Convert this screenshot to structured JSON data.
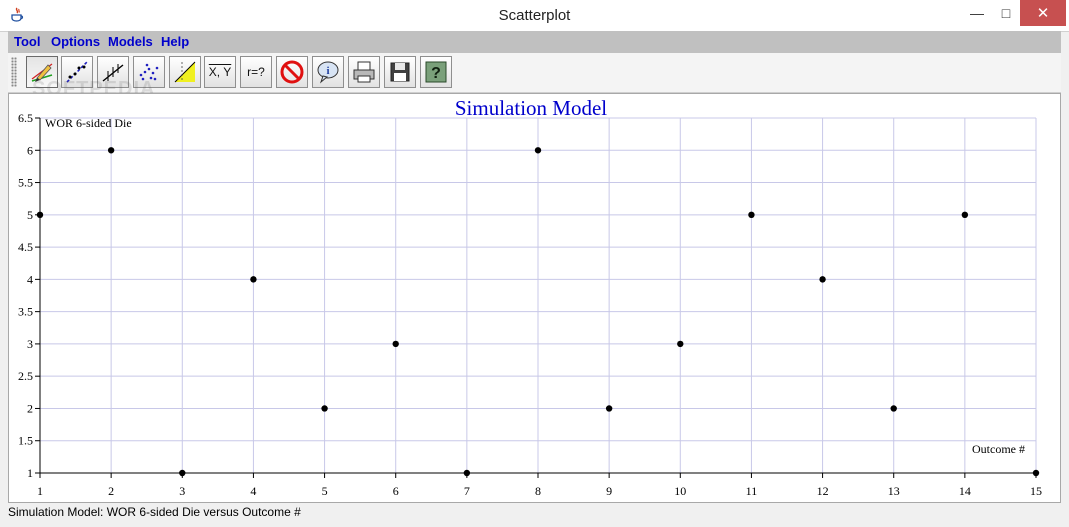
{
  "window": {
    "title": "Scatterplot",
    "min_glyph": "—",
    "max_glyph": "□",
    "close_glyph": "✕"
  },
  "menu": [
    {
      "label": "Tool"
    },
    {
      "label": "Options"
    },
    {
      "label": "Models"
    },
    {
      "label": "Help"
    }
  ],
  "toolbar": {
    "mean_label": "X, Y",
    "r_label": "r=?",
    "active_tool": "draw-line"
  },
  "watermark": "SOFTPEDIA",
  "chart_data": {
    "type": "scatter",
    "title": "Simulation Model",
    "ylabel": "WOR 6-sided Die",
    "xlabel": "Outcome #",
    "x": [
      1,
      2,
      3,
      4,
      5,
      6,
      7,
      8,
      9,
      10,
      11,
      12,
      13,
      14,
      15
    ],
    "y": [
      5,
      6,
      1,
      4,
      2,
      3,
      1,
      6,
      2,
      3,
      5,
      4,
      2,
      5,
      1
    ],
    "xlim": [
      1,
      15
    ],
    "ylim": [
      1,
      6.5
    ],
    "xticks": [
      1,
      2,
      3,
      4,
      5,
      6,
      7,
      8,
      9,
      10,
      11,
      12,
      13,
      14,
      15
    ],
    "yticks": [
      1,
      1.5,
      2,
      2.5,
      3,
      3.5,
      4,
      4.5,
      5,
      5.5,
      6,
      6.5
    ],
    "grid": true,
    "colors": {
      "point": "#000000",
      "grid": "#c8c8e8",
      "title": "#0000cc"
    }
  },
  "status": {
    "text": "Simulation Model: WOR 6-sided Die versus Outcome #"
  }
}
